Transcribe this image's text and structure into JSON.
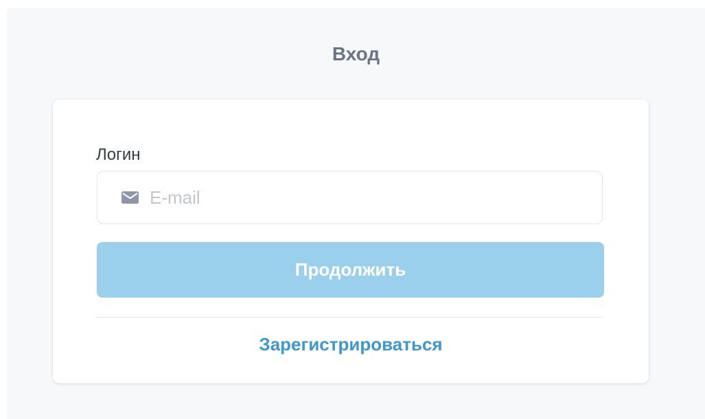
{
  "page": {
    "title": "Вход"
  },
  "form": {
    "login_label": "Логин",
    "email_placeholder": "E-mail",
    "email_value": "",
    "email_icon": "mail-icon",
    "continue_label": "Продолжить",
    "register_label": "Зарегистрироваться"
  },
  "colors": {
    "background": "#f7f8fa",
    "card": "#ffffff",
    "title": "#6c7483",
    "button_disabled": "#9ad0ec",
    "link": "#3d98cc",
    "placeholder": "#c3c6d0"
  }
}
